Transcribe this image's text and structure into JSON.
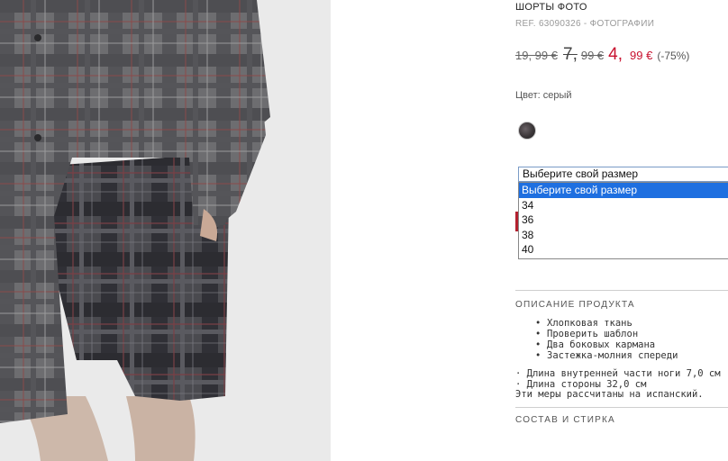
{
  "product": {
    "title": "ШОРТЫ ФОТО",
    "ref": "REF. 63090326 - ФОТОГРАФИИ"
  },
  "price": {
    "old_1": "19, 99 €",
    "old_2_int": "7,",
    "old_2_dec": "99 €",
    "new_int": "4,",
    "new_dec": "99 €",
    "discount": "(-75%)"
  },
  "color": {
    "label": "Цвет: серый",
    "swatch_hex": "#3b3638"
  },
  "size_select": {
    "value": "Выберите свой размер",
    "options": [
      "Выберите свой размер",
      "34",
      "36",
      "38",
      "40"
    ],
    "selected_index": 0
  },
  "description": {
    "heading": "ОПИСАНИЕ ПРОДУКТА",
    "features": [
      "Хлопковая ткань",
      "Проверить шаблон",
      "Два боковых кармана",
      "Застежка-молния спереди"
    ],
    "measures": [
      "· Длина внутренней части ноги 7,0 см",
      "· Длина стороны 32,0 см",
      "Эти меры рассчитаны на испанский."
    ]
  },
  "composition": {
    "heading": "СОСТАВ И СТИРКА"
  },
  "colors": {
    "sale_red": "#c8102e",
    "select_highlight": "#1e6fe0"
  }
}
